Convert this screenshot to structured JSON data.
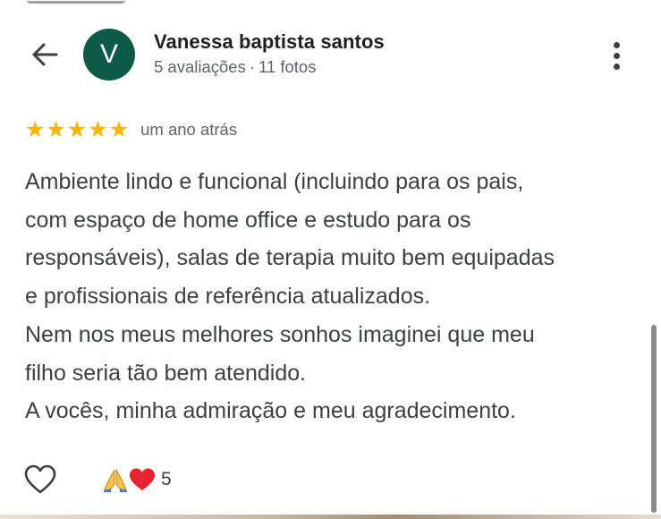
{
  "header": {
    "back_icon": "arrow-left-icon",
    "avatar_letter": "V",
    "avatar_color": "#0d5a47",
    "name": "Vanessa baptista santos",
    "reviews_count": "5 avaliações",
    "separator": "·",
    "photos_count": "11 fotos",
    "menu_icon": "more-vertical-icon"
  },
  "review": {
    "rating": 5,
    "max_rating": 5,
    "star_color": "#f9b300",
    "time_ago": "um ano atrás",
    "lines": [
      "Ambiente lindo e funcional (incluindo para os pais,",
      "com espaço de home office e estudo para os",
      "responsáveis), salas de terapia muito bem equipadas",
      "e profissionais de referência atualizados.",
      "Nem nos meus melhores sonhos imaginei que meu",
      "filho seria tão bem atendido.",
      "A vocês, minha admiração e meu agradecimento."
    ]
  },
  "reactions": {
    "like_icon": "heart-outline-icon",
    "emojis": [
      "pray-emoji-icon",
      "red-heart-emoji-icon"
    ],
    "count": "5"
  }
}
